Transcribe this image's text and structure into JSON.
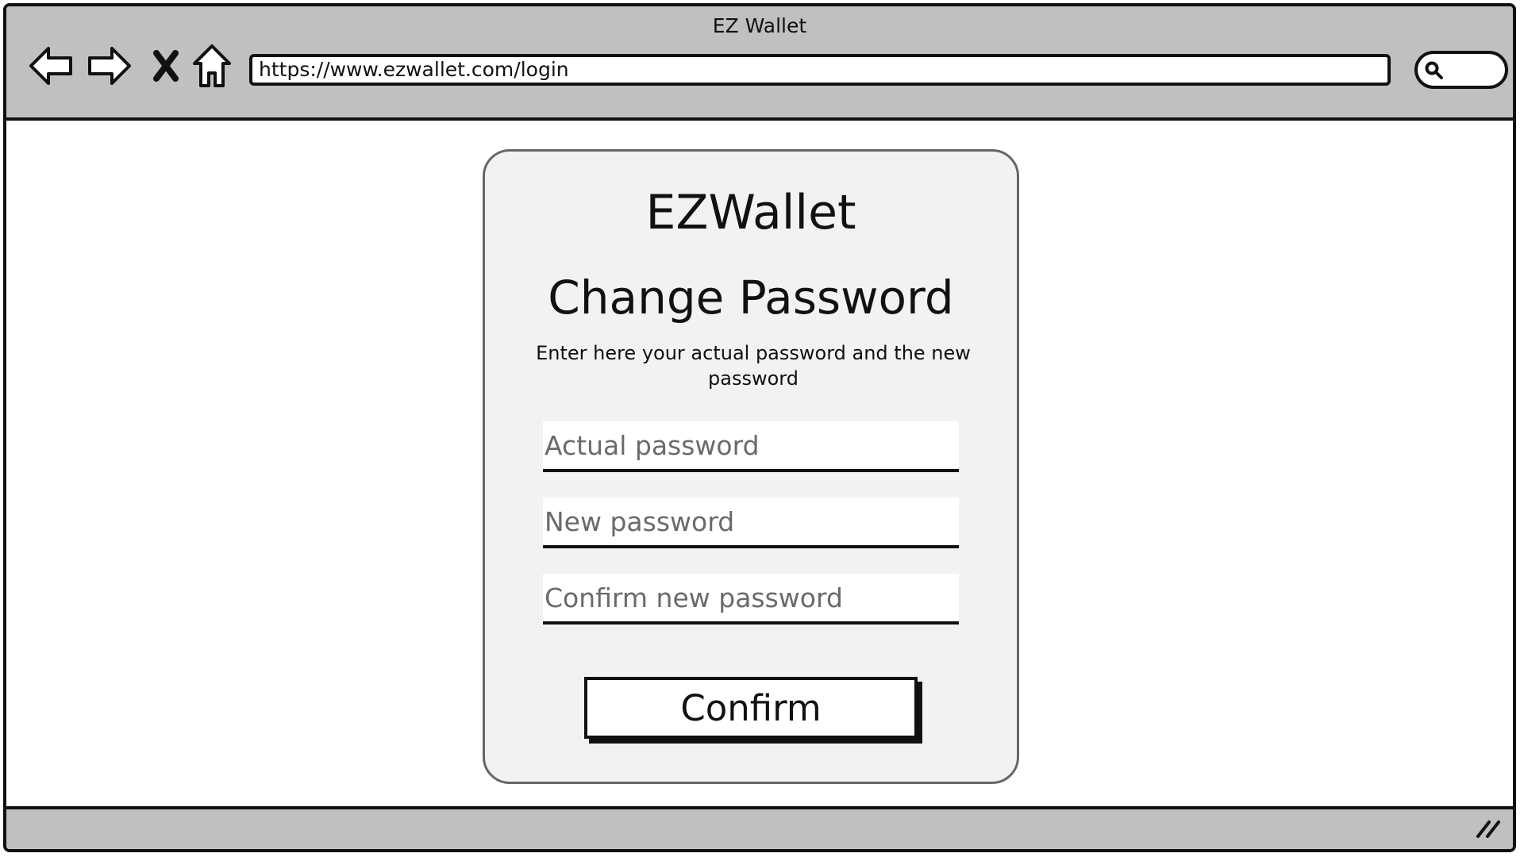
{
  "browser": {
    "window_title": "EZ Wallet",
    "url": "https://www.ezwallet.com/login",
    "icons": {
      "back": "back-arrow-icon",
      "forward": "forward-arrow-icon",
      "stop": "close-x-icon",
      "home": "home-icon",
      "search": "search-icon",
      "resize": "resize-grip-icon"
    }
  },
  "form": {
    "brand": "EZWallet",
    "heading": "Change Password",
    "subtitle": "Enter here your actual password and the new password",
    "fields": [
      {
        "placeholder": "Actual password",
        "value": ""
      },
      {
        "placeholder": "New password",
        "value": ""
      },
      {
        "placeholder": "Confirm new password",
        "value": ""
      }
    ],
    "confirm_label": "Confirm"
  }
}
